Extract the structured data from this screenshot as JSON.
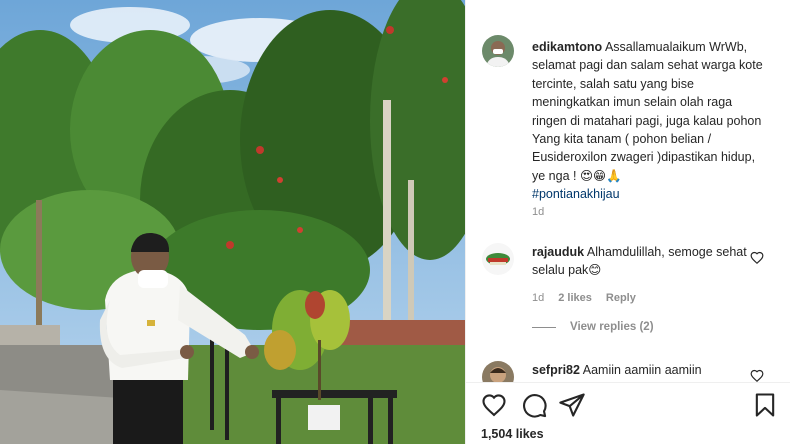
{
  "post": {
    "username": "edikamtono",
    "caption": "Assallamualaikum WrWb, selamat pagi dan salam sehat warga kote tercinte, salah satu yang bise meningkatkan imun selain olah raga ringen di matahari pagi, juga kalau pohon Yang kita tanam ( pohon belian / Eusideroxilon zwageri )dipastikan hidup, ye nga ! 😍😁🙏",
    "hashtag": "#pontianakhijau",
    "age": "1d"
  },
  "comments": [
    {
      "username": "rajauduk",
      "text": "Alhamdulillah, semoge sehat selalu pak😊",
      "age": "1d",
      "likes": "2 likes",
      "reply": "Reply",
      "view_replies": "View replies (2)"
    },
    {
      "username": "sefpri82",
      "text": "Aamiin aamiin aamiin"
    }
  ],
  "actions": {
    "like_icon": "heart-icon",
    "comment_icon": "comment-icon",
    "share_icon": "share-icon",
    "save_icon": "bookmark-icon"
  },
  "likes_count": "1,504 likes",
  "colors": {
    "text": "#262626",
    "secondary": "#8e8e8e",
    "hashtag": "#00376b",
    "border": "#efefef"
  }
}
